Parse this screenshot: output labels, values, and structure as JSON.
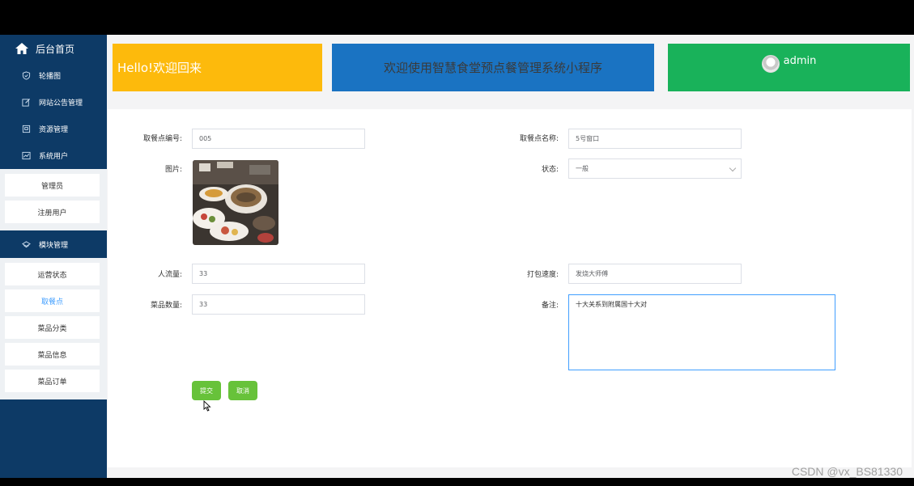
{
  "sidebar": {
    "home_label": "后台首页",
    "items": [
      {
        "label": "轮播图",
        "icon": "shield-icon"
      },
      {
        "label": "网站公告管理",
        "icon": "edit-icon"
      },
      {
        "label": "资源管理",
        "icon": "box-icon"
      },
      {
        "label": "系统用户",
        "icon": "chart-icon"
      }
    ],
    "user_sub": [
      "管理员",
      "注册用户"
    ],
    "module_group": {
      "label": "模块管理",
      "icon": "layers-icon"
    },
    "module_sub": [
      {
        "label": "运营状态",
        "active": false
      },
      {
        "label": "取餐点",
        "active": true
      },
      {
        "label": "菜品分类",
        "active": false
      },
      {
        "label": "菜品信息",
        "active": false
      },
      {
        "label": "菜品订单",
        "active": false
      }
    ]
  },
  "header": {
    "hello": "Hello!欢迎回来",
    "welcome": "欢迎使用智慧食堂预点餐管理系统小程序",
    "user": "admin"
  },
  "form": {
    "code_label": "取餐点编号:",
    "code_value": "005",
    "name_label": "取餐点名称:",
    "name_value": "5号窗口",
    "image_label": "图片:",
    "status_label": "状态:",
    "status_value": "一般",
    "traffic_label": "人流量:",
    "traffic_value": "33",
    "pack_label": "打包速度:",
    "pack_value": "发烧大师傅",
    "dish_count_label": "菜品数量:",
    "dish_count_value": "33",
    "remark_label": "备注:",
    "remark_value": "十大关系到附属国十大对",
    "submit_label": "提交",
    "cancel_label": "取消"
  },
  "watermark": "CSDN @vx_BS81330",
  "colors": {
    "sidebar": "#0d3a66",
    "hello_card": "#fdba0c",
    "welcome_card": "#1a73c2",
    "admin_card": "#19b25a",
    "button": "#67c23a",
    "active_link": "#409eff"
  }
}
